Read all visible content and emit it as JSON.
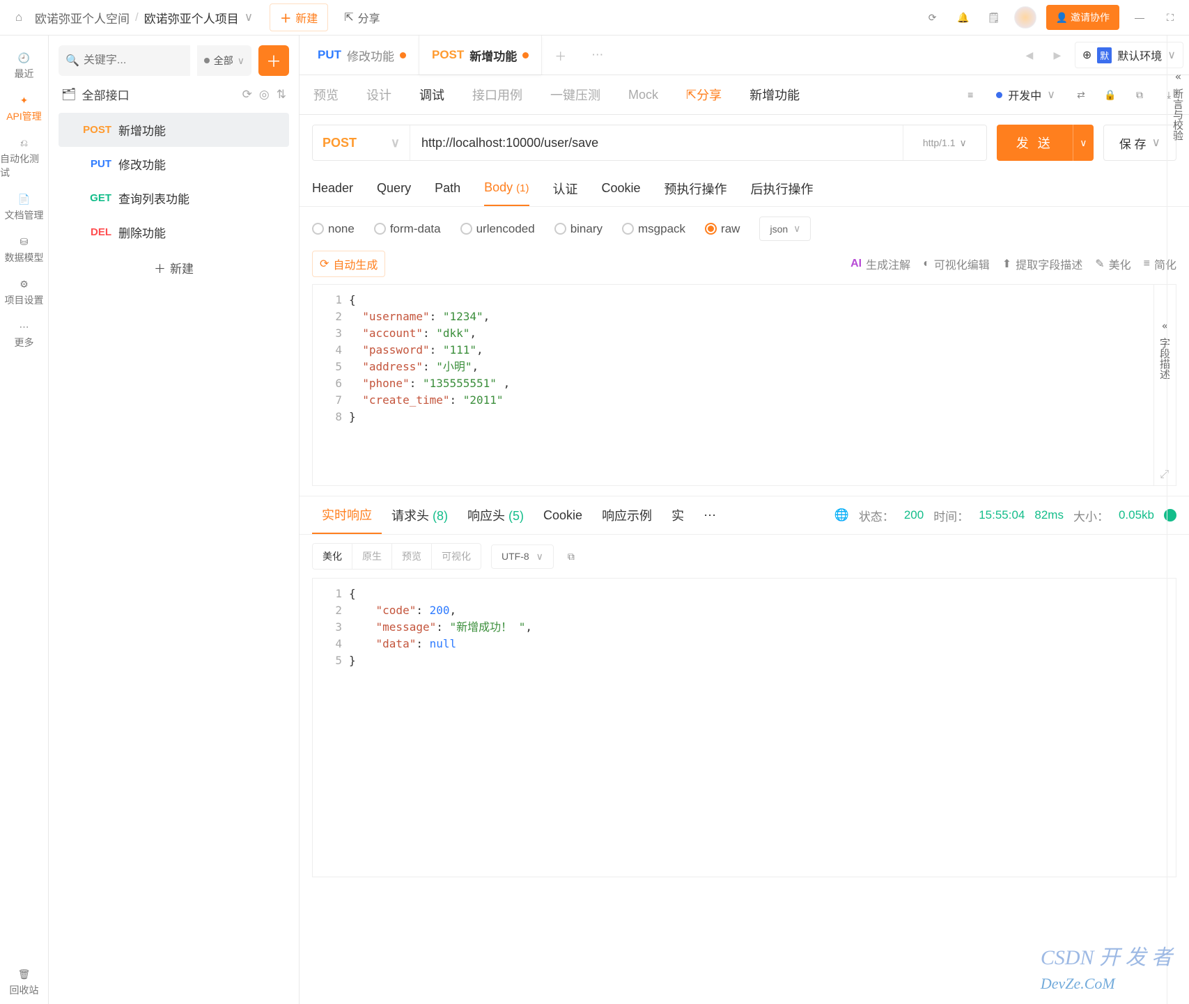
{
  "top": {
    "workspace": "欧诺弥亚个人空间",
    "project": "欧诺弥亚个人项目",
    "new": "新建",
    "share": "分享",
    "invite": "邀请协作"
  },
  "nav": {
    "recent": "最近",
    "api": "API管理",
    "auto": "自动化测试",
    "doc": "文档管理",
    "data": "数据模型",
    "proj": "项目设置",
    "more": "更多",
    "recycle": "回收站"
  },
  "side": {
    "search_ph": "关键字...",
    "filter": "全部",
    "all_api": "全部接口",
    "new": "新建",
    "items": [
      {
        "m": "POST",
        "cls": "m-post",
        "t": "新增功能"
      },
      {
        "m": "PUT",
        "cls": "m-put",
        "t": "修改功能"
      },
      {
        "m": "GET",
        "cls": "m-get",
        "t": "查询列表功能"
      },
      {
        "m": "DEL",
        "cls": "m-del",
        "t": "删除功能"
      }
    ]
  },
  "tabs": [
    {
      "m": "PUT",
      "cls": "m-put",
      "t": "修改功能"
    },
    {
      "m": "POST",
      "cls": "m-post",
      "t": "新增功能"
    }
  ],
  "env": {
    "badge": "默",
    "label": "默认环境"
  },
  "subtabs": {
    "preview": "预览",
    "design": "设计",
    "debug": "调试",
    "cases": "接口用例",
    "stress": "一键压测",
    "mock": "Mock",
    "share": "分享",
    "title": "新增功能"
  },
  "status_sel": "开发中",
  "url": {
    "method": "POST",
    "value": "http://localhost:10000/user/save",
    "proto": "http/1.1",
    "send": "发 送",
    "save": "保 存"
  },
  "req_tabs": {
    "header": "Header",
    "query": "Query",
    "path": "Path",
    "body": "Body",
    "body_cnt": "(1)",
    "auth": "认证",
    "cookie": "Cookie",
    "pre": "预执行操作",
    "post": "后执行操作"
  },
  "body_types": {
    "none": "none",
    "form": "form-data",
    "url": "urlencoded",
    "binary": "binary",
    "msg": "msgpack",
    "raw": "raw",
    "sel": "json"
  },
  "toolbar": {
    "gen": "自动生成",
    "ai": "生成注解",
    "vis": "可视化编辑",
    "ext": "提取字段描述",
    "fmt": "美化",
    "min": "简化"
  },
  "body_lines": [
    {
      "t": "{"
    },
    {
      "k": "username",
      "v": "1234",
      "c": ","
    },
    {
      "k": "account",
      "v": "dkk",
      "c": ","
    },
    {
      "k": "password",
      "v": "111",
      "c": ","
    },
    {
      "k": "address",
      "v": "小明",
      "c": ","
    },
    {
      "k": "phone",
      "v": "135555551",
      "c": " ,"
    },
    {
      "k": "create_time",
      "v": "2011",
      "c": ""
    },
    {
      "t": "}"
    }
  ],
  "rail1": "字段描述",
  "resp_tabs": {
    "live": "实时响应",
    "reqh": "请求头",
    "reqh_cnt": "(8)",
    "resh": "响应头",
    "resh_cnt": "(5)",
    "cookie": "Cookie",
    "ex": "响应示例",
    "tr": "实"
  },
  "resp_meta": {
    "status_l": "状态：",
    "status_v": "200",
    "time_l": "时间：",
    "time_v": "15:55:04",
    "dur": "82ms",
    "size_l": "大小：",
    "size_v": "0.05kb"
  },
  "resp_tools": {
    "fmt": "美化",
    "raw": "原生",
    "pv": "预览",
    "vis": "可视化",
    "enc": "UTF-8"
  },
  "resp_lines": [
    {
      "t": "{"
    },
    {
      "k": "code",
      "n": 200,
      "c": ","
    },
    {
      "k": "message",
      "v": "新增成功！ ",
      "c": ","
    },
    {
      "k": "data",
      "nul": "null",
      "c": ""
    },
    {
      "t": "}"
    }
  ],
  "rail2": "断言与校验",
  "wm": {
    "a": "CSDN ",
    "b": "开 发 者",
    "c": "DevZe.CoM"
  }
}
